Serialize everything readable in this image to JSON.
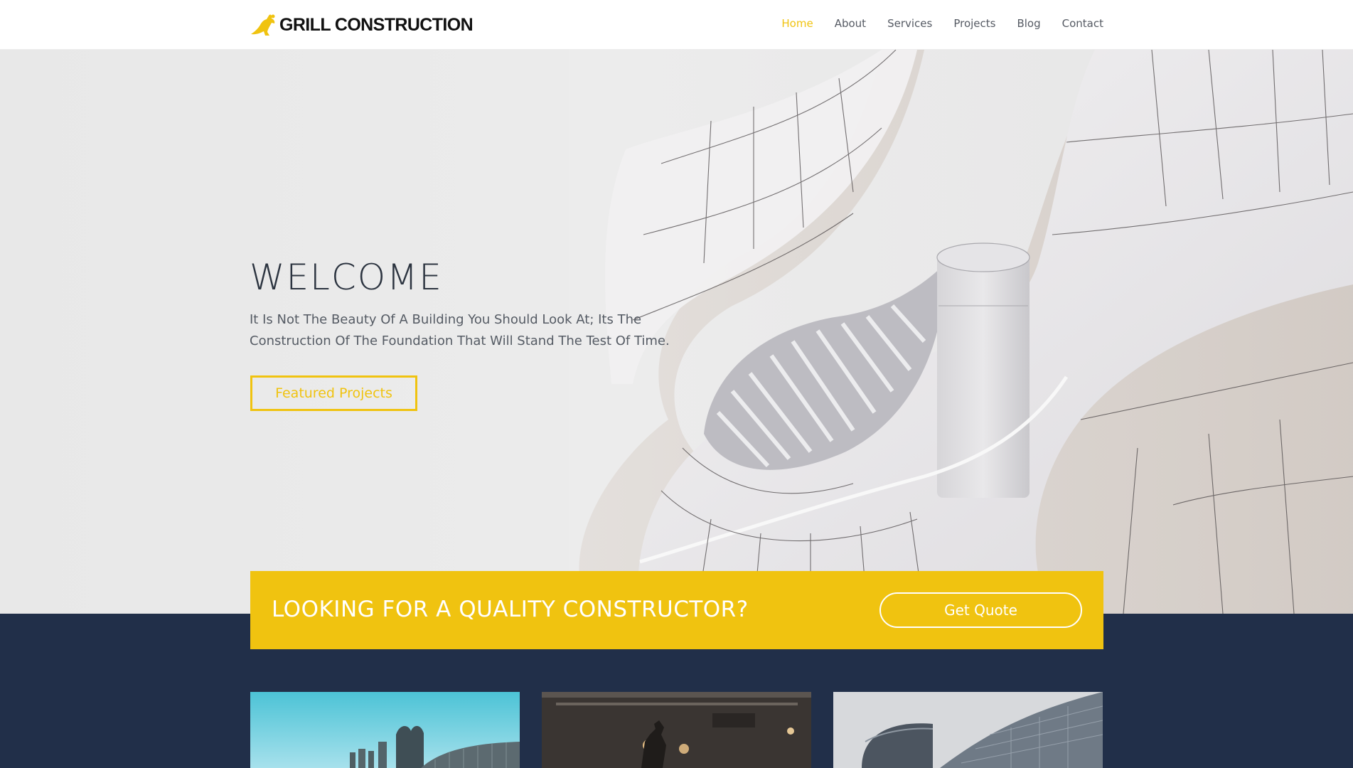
{
  "header": {
    "logo_text": "GRILL CONSTRUCTION",
    "nav": [
      {
        "label": "Home",
        "active": true
      },
      {
        "label": "About",
        "active": false
      },
      {
        "label": "Services",
        "active": false
      },
      {
        "label": "Projects",
        "active": false
      },
      {
        "label": "Blog",
        "active": false
      },
      {
        "label": "Contact",
        "active": false
      }
    ]
  },
  "hero": {
    "title": "WELCOME",
    "tagline": "It Is Not The Beauty Of A Building You Should Look At; Its The Construction Of The Foundation That Will Stand The Test Of Time.",
    "button_label": "Featured Projects"
  },
  "cta": {
    "text": "LOOKING FOR A QUALITY CONSTRUCTOR?",
    "button_label": "Get Quote"
  },
  "colors": {
    "accent": "#f0c310",
    "dark_navy": "#212f49",
    "text_dark": "#2c3440"
  },
  "icons": {
    "logo": "running-figure-logo-icon"
  }
}
